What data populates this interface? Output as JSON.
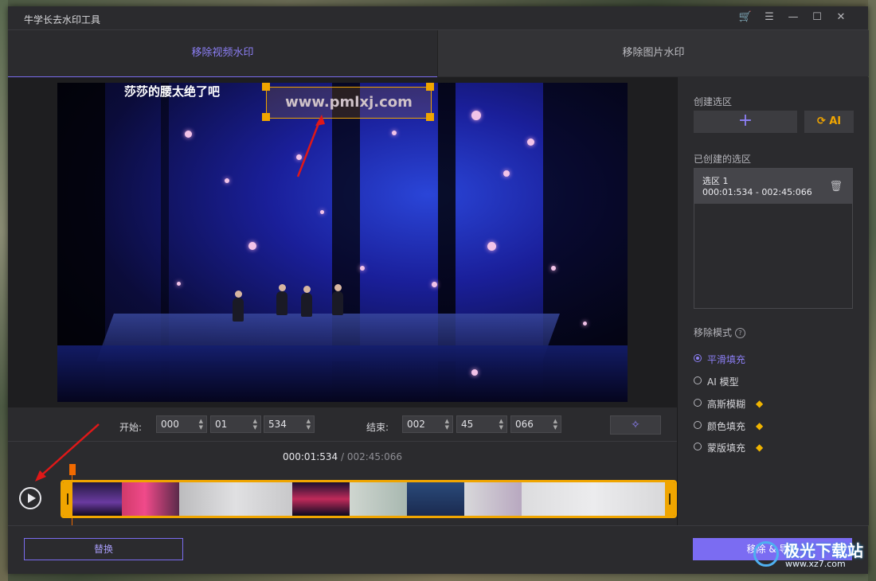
{
  "app": {
    "title": "牛学长去水印工具"
  },
  "window_controls": {
    "cart": "🛒",
    "menu": "☰",
    "minimize": "—",
    "maximize": "☐",
    "close": "✕"
  },
  "tabs": [
    {
      "label": "移除视频水印",
      "active": true
    },
    {
      "label": "移除图片水印",
      "active": false
    }
  ],
  "video": {
    "caption": "莎莎的腰太绝了吧",
    "watermark_text": "www.pmlxj.com"
  },
  "controls": {
    "start_label": "开始:",
    "start": {
      "h": "000",
      "m": "01",
      "ms": "534"
    },
    "end_label": "结束:",
    "end": {
      "h": "002",
      "m": "45",
      "ms": "066"
    },
    "magic_icon": "✧"
  },
  "timeline": {
    "current": "000:01:534",
    "separator": " / ",
    "total": "002:45:066"
  },
  "panel": {
    "create_label": "创建选区",
    "add_icon": "+",
    "ai_label": "AI",
    "created_label": "已创建的选区",
    "selections": [
      {
        "name": "选区 1",
        "range": "000:01:534 - 002:45:066"
      }
    ],
    "trash_icon": "🗑",
    "mode_label": "移除模式",
    "help_icon": "?",
    "modes": [
      {
        "label": "平滑填充",
        "selected": true,
        "premium": false
      },
      {
        "label": "AI 模型",
        "selected": false,
        "premium": false
      },
      {
        "label": "高斯模糊",
        "selected": false,
        "premium": true
      },
      {
        "label": "颜色填充",
        "selected": false,
        "premium": true
      },
      {
        "label": "蒙版填充",
        "selected": false,
        "premium": true
      }
    ],
    "gem_icon": "◆"
  },
  "bottom": {
    "replace_label": "替换",
    "remove_label": "移除 & 导出"
  },
  "site_watermark": {
    "big": "极光下载站",
    "small": "www.xz7.com"
  },
  "colors": {
    "accent": "#7b6cf2",
    "handle": "#f0a500",
    "bg": "#2b2b2e"
  }
}
